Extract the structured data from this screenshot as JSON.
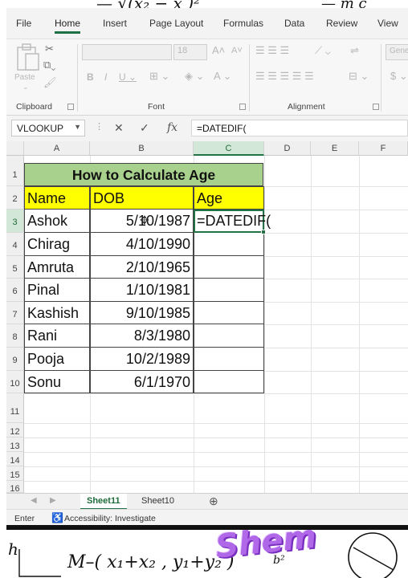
{
  "ribbon": {
    "tabs": [
      "File",
      "Home",
      "Insert",
      "Page Layout",
      "Formulas",
      "Data",
      "Review",
      "View"
    ],
    "active_tab": "Home",
    "font_size": "18",
    "paste_label": "Paste",
    "number_format_partial": "Gene",
    "groups": {
      "clipboard": "Clipboard",
      "font": "Font",
      "alignment": "Alignment"
    }
  },
  "formula_bar": {
    "name_box": "VLOOKUP",
    "cancel_icon": "✕",
    "enter_icon": "✓",
    "fx_label": "fx",
    "content": "=DATEDIF("
  },
  "columns": [
    "A",
    "B",
    "C",
    "D",
    "E",
    "F"
  ],
  "rows": [
    "1",
    "2",
    "3",
    "4",
    "5",
    "6",
    "7",
    "8",
    "9",
    "10",
    "11",
    "12",
    "13",
    "14",
    "15",
    "16"
  ],
  "table": {
    "title": "How to Calculate Age",
    "headers": {
      "name": "Name",
      "dob": "DOB",
      "age": "Age"
    },
    "records": [
      {
        "name": "Ashok",
        "dob": "5/10/1987"
      },
      {
        "name": "Chirag",
        "dob": "4/10/1990"
      },
      {
        "name": "Amruta",
        "dob": "2/10/1965"
      },
      {
        "name": "Pinal",
        "dob": "1/10/1981"
      },
      {
        "name": "Kashish",
        "dob": "9/10/1985"
      },
      {
        "name": "Rani",
        "dob": "8/3/1980"
      },
      {
        "name": "Pooja",
        "dob": "10/2/1989"
      },
      {
        "name": "Sonu",
        "dob": "6/1/1970"
      }
    ],
    "active_cell_text": "=DATEDIF("
  },
  "sheets": [
    "Sheet11",
    "Sheet10"
  ],
  "active_sheet": "Sheet11",
  "status": {
    "mode": "Enter",
    "accessibility": "Accessibility: Investigate"
  },
  "watermark": "Shem",
  "colors": {
    "title_fill": "#a9d18e",
    "header_fill": "#ffff00",
    "excel_green": "#217346"
  }
}
